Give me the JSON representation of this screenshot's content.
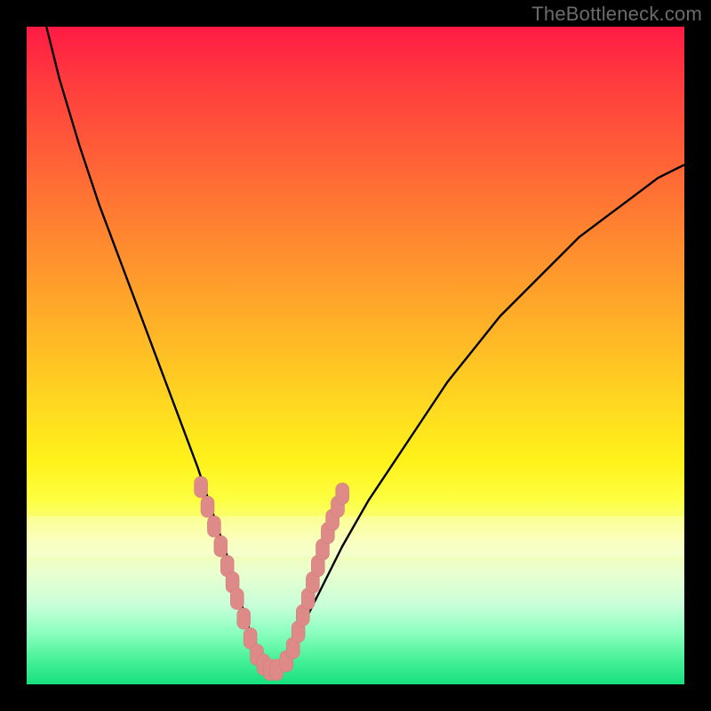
{
  "watermark": "TheBottleneck.com",
  "colors": {
    "curve_stroke": "#000000",
    "marker_fill": "#dd8a88",
    "marker_stroke": "#cf7a78",
    "background_frame": "#000000"
  },
  "chart_data": {
    "type": "line",
    "title": "",
    "xlabel": "",
    "ylabel": "",
    "xlim": [
      0,
      100
    ],
    "ylim": [
      0,
      100
    ],
    "grid": false,
    "legend": false,
    "series": [
      {
        "name": "bottleneck-curve",
        "x": [
          3,
          5,
          8,
          11,
          14,
          17,
          20,
          23,
          26,
          28,
          30,
          32,
          33,
          34,
          35,
          36,
          37,
          38,
          39,
          40,
          42,
          45,
          48,
          52,
          56,
          60,
          64,
          68,
          72,
          76,
          80,
          84,
          88,
          92,
          96,
          100
        ],
        "y": [
          100,
          92,
          82,
          73,
          65,
          57,
          49,
          41,
          33,
          27,
          21,
          15,
          11,
          8,
          5,
          3,
          2,
          2,
          3,
          5,
          9,
          15,
          21,
          28,
          34,
          40,
          46,
          51,
          56,
          60,
          64,
          68,
          71,
          74,
          77,
          79
        ]
      }
    ],
    "markers": {
      "name": "highlighted-points",
      "x": [
        26.5,
        27.5,
        28.5,
        29.5,
        30.5,
        31.3,
        32.0,
        33.0,
        34.0,
        35.0,
        36.0,
        37.0,
        38.0,
        39.5,
        40.5,
        41.3,
        42.0,
        42.8,
        43.5,
        44.3,
        45.0,
        45.8,
        46.5,
        47.3,
        48.0
      ],
      "y": [
        30.0,
        27.0,
        24.0,
        21.0,
        18.0,
        15.5,
        13.0,
        10.0,
        7.0,
        4.5,
        3.0,
        2.2,
        2.2,
        3.5,
        5.5,
        8.0,
        10.5,
        13.0,
        15.5,
        18.0,
        20.5,
        23.0,
        25.0,
        27.0,
        29.0
      ]
    }
  }
}
